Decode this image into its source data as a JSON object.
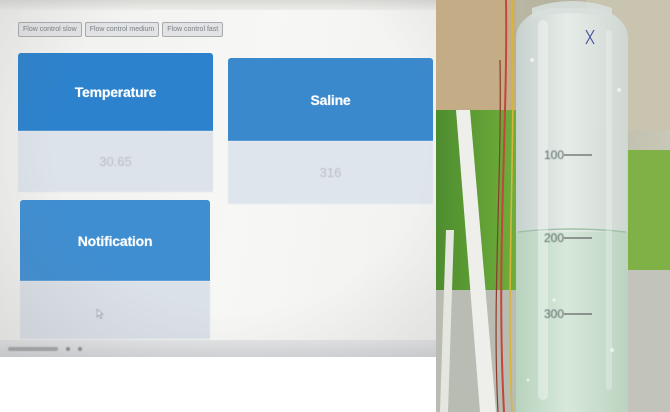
{
  "controls": {
    "flow_buttons": [
      "Flow control slow",
      "Flow control medium",
      "Flow control fast"
    ]
  },
  "cards": {
    "temperature": {
      "title": "Temperature",
      "value": "30.65"
    },
    "saline": {
      "title": "Saline",
      "value": "316"
    },
    "notification": {
      "title": "Notification",
      "value": ""
    }
  },
  "bottle": {
    "scale_marks": [
      "100",
      "200",
      "300"
    ]
  },
  "colors": {
    "card_header_blue": "#2c82cc",
    "card_body_grey": "#dde3ea",
    "liquid_green": "#cfe3d3"
  },
  "icons": [
    "mouse-cursor-icon"
  ]
}
